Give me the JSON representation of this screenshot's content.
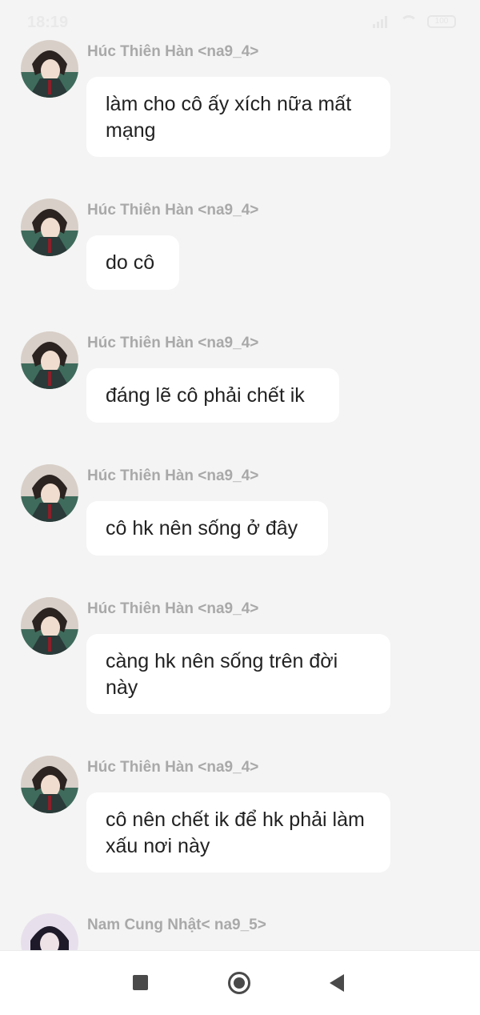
{
  "status_bar": {
    "time": "18:19",
    "battery": "100"
  },
  "messages": [
    {
      "sender": "Húc Thiên Hàn <na9_4>",
      "text": "làm cho cô ấy xích nữa mất mạng",
      "avatar": "avatar-boy-icon"
    },
    {
      "sender": "Húc Thiên Hàn <na9_4>",
      "text": "do cô",
      "avatar": "avatar-boy-icon"
    },
    {
      "sender": "Húc Thiên Hàn <na9_4>",
      "text": "đáng lẽ cô phải chết ik",
      "avatar": "avatar-boy-icon"
    },
    {
      "sender": "Húc Thiên Hàn <na9_4>",
      "text": "cô hk nên sống ở đây",
      "avatar": "avatar-boy-icon"
    },
    {
      "sender": "Húc Thiên Hàn <na9_4>",
      "text": "càng hk nên sống trên đời này",
      "avatar": "avatar-boy-icon"
    },
    {
      "sender": "Húc Thiên Hàn <na9_4>",
      "text": "cô nên chết ik để hk phải làm xấu nơi này",
      "avatar": "avatar-boy-icon"
    },
    {
      "sender": "Nam Cung Nhật< na9_5>",
      "text": "",
      "avatar": "avatar-girl-icon"
    }
  ],
  "nav_bar": {
    "icons": [
      "recents-square-icon",
      "home-circle-icon",
      "back-triangle-icon"
    ]
  }
}
